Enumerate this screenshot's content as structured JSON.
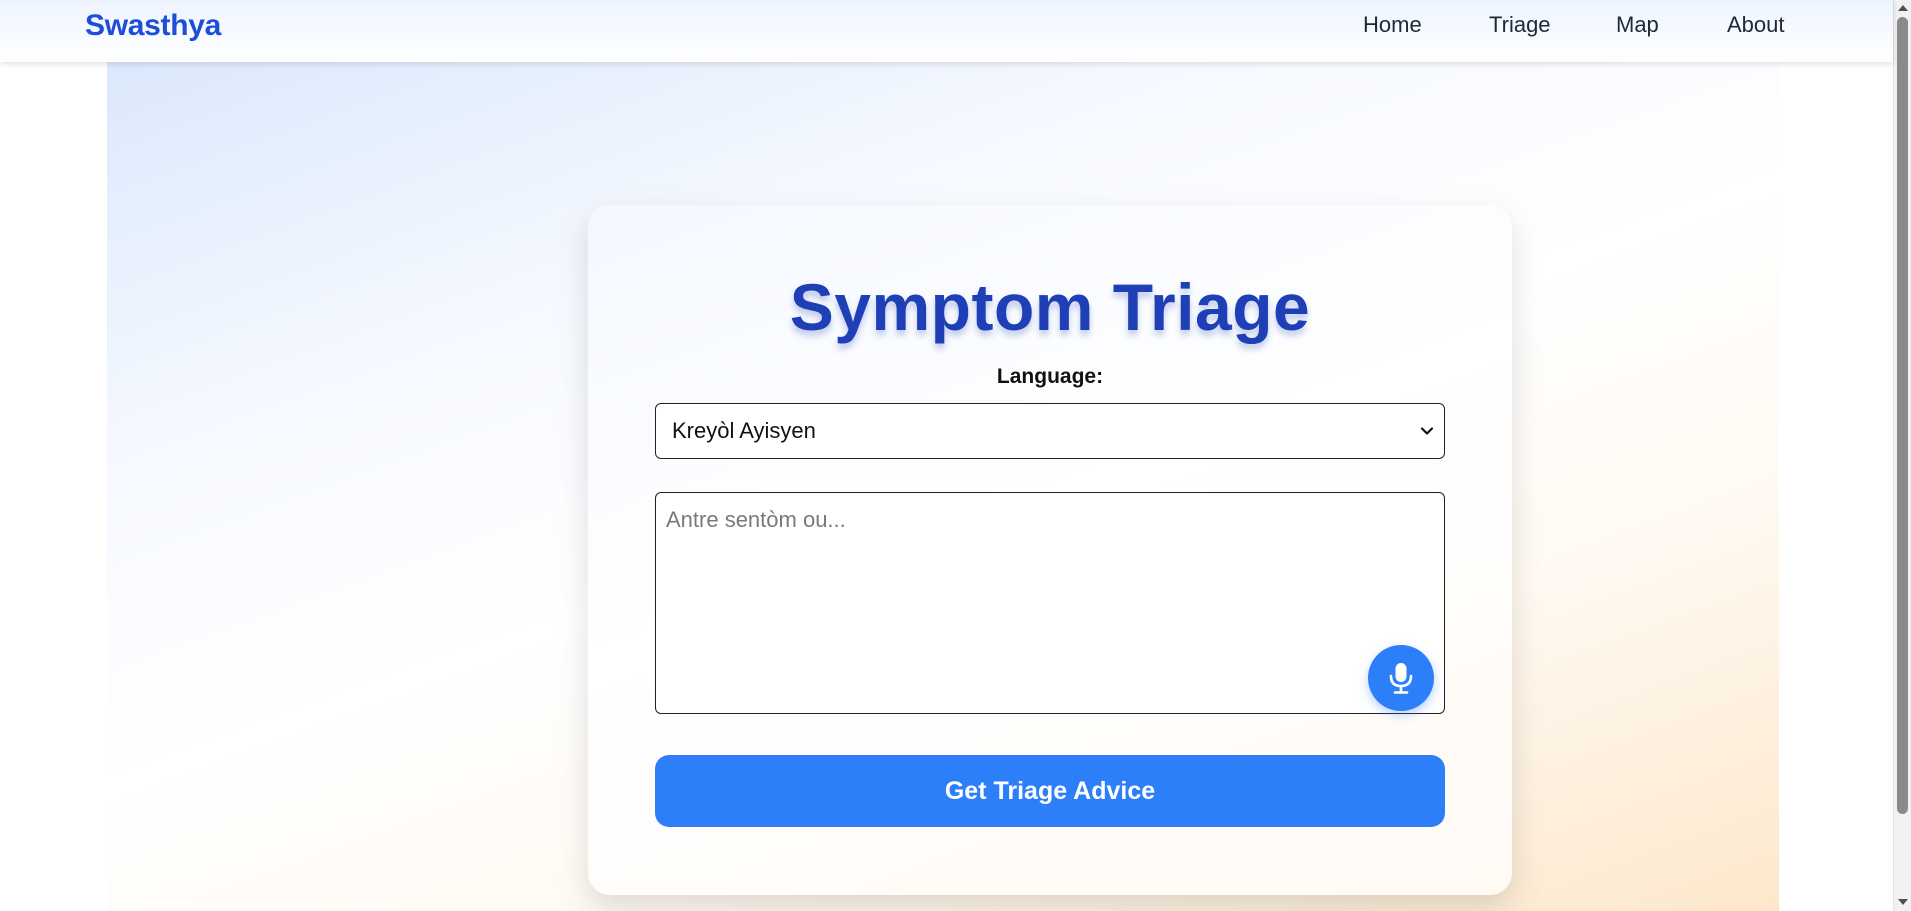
{
  "navbar": {
    "brand": "Swasthya",
    "links": [
      {
        "label": "Home"
      },
      {
        "label": "Triage"
      },
      {
        "label": "Map"
      },
      {
        "label": "About"
      }
    ]
  },
  "triage": {
    "title": "Symptom Triage",
    "language_label": "Language:",
    "language_selected": "Kreyòl Ayisyen",
    "symptom_placeholder": "Antre sentòm ou...",
    "symptom_value": "",
    "submit_label": "Get Triage Advice"
  },
  "icons": {
    "mic": "microphone-icon",
    "chevron": "chevron-down-icon"
  },
  "colors": {
    "brand": "#1d4ed8",
    "title": "#1e3fb5",
    "accent": "#2d7ff9"
  }
}
